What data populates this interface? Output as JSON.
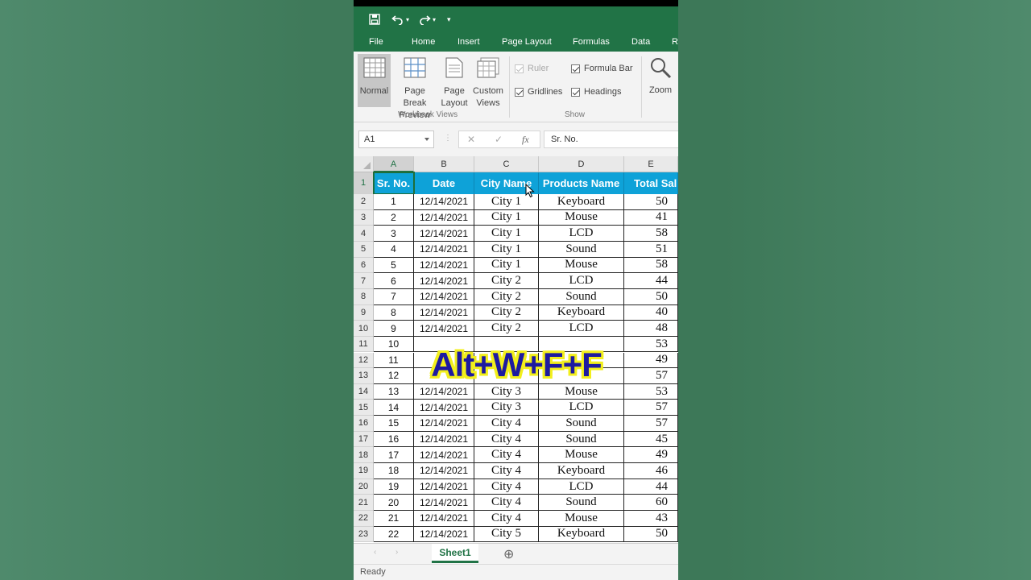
{
  "qat": {
    "save_icon": "save-icon",
    "undo_icon": "undo-icon",
    "redo_icon": "redo-icon",
    "customize_glyph": "▾"
  },
  "ribbon_tabs": [
    "File",
    "Home",
    "Insert",
    "Page Layout",
    "Formulas",
    "Data",
    "R"
  ],
  "ribbon": {
    "views": [
      {
        "line1": "Normal",
        "line2": "",
        "icon": "normal-view-icon"
      },
      {
        "line1": "Page Break",
        "line2": "Preview",
        "icon": "page-break-icon"
      },
      {
        "line1": "Page",
        "line2": "Layout",
        "icon": "page-layout-icon"
      },
      {
        "line1": "Custom",
        "line2": "Views",
        "icon": "custom-views-icon"
      }
    ],
    "views_group": "Workbook Views",
    "show": {
      "ruler": "Ruler",
      "formula_bar": "Formula Bar",
      "gridlines": "Gridlines",
      "headings": "Headings"
    },
    "show_group": "Show",
    "zoom": "Zoom"
  },
  "formula_bar": {
    "name_box": "A1",
    "cancel": "✕",
    "enter": "✓",
    "fx": "fx",
    "content": "Sr. No."
  },
  "columns": [
    "A",
    "B",
    "C",
    "D",
    "E"
  ],
  "table": {
    "headers": [
      "Sr. No.",
      "Date",
      "City Name",
      "Products Name",
      "Total Sal"
    ],
    "rows": [
      [
        "1",
        "12/14/2021",
        "City 1",
        "Keyboard",
        "50"
      ],
      [
        "2",
        "12/14/2021",
        "City 1",
        "Mouse",
        "41"
      ],
      [
        "3",
        "12/14/2021",
        "City 1",
        "LCD",
        "58"
      ],
      [
        "4",
        "12/14/2021",
        "City 1",
        "Sound",
        "51"
      ],
      [
        "5",
        "12/14/2021",
        "City 1",
        "Mouse",
        "58"
      ],
      [
        "6",
        "12/14/2021",
        "City 2",
        "LCD",
        "44"
      ],
      [
        "7",
        "12/14/2021",
        "City 2",
        "Sound",
        "50"
      ],
      [
        "8",
        "12/14/2021",
        "City 2",
        "Keyboard",
        "40"
      ],
      [
        "9",
        "12/14/2021",
        "City 2",
        "LCD",
        "48"
      ],
      [
        "10",
        "",
        "",
        "",
        "53"
      ],
      [
        "11",
        "",
        "",
        "",
        "49"
      ],
      [
        "12",
        "",
        "",
        "",
        "57"
      ],
      [
        "13",
        "12/14/2021",
        "City 3",
        "Mouse",
        "53"
      ],
      [
        "14",
        "12/14/2021",
        "City 3",
        "LCD",
        "57"
      ],
      [
        "15",
        "12/14/2021",
        "City 4",
        "Sound",
        "57"
      ],
      [
        "16",
        "12/14/2021",
        "City 4",
        "Sound",
        "45"
      ],
      [
        "17",
        "12/14/2021",
        "City 4",
        "Mouse",
        "49"
      ],
      [
        "18",
        "12/14/2021",
        "City 4",
        "Keyboard",
        "46"
      ],
      [
        "19",
        "12/14/2021",
        "City 4",
        "LCD",
        "44"
      ],
      [
        "20",
        "12/14/2021",
        "City 4",
        "Sound",
        "60"
      ],
      [
        "21",
        "12/14/2021",
        "City 4",
        "Mouse",
        "43"
      ],
      [
        "22",
        "12/14/2021",
        "City 5",
        "Keyboard",
        "50"
      ]
    ]
  },
  "sheet_tabs": {
    "active": "Sheet1",
    "add_icon": "⊕"
  },
  "status": "Ready",
  "overlay_text": "Alt+W+F+F",
  "colors": {
    "excel_green": "#217346",
    "header_blue": "#0ea2d8",
    "overlay_yellow": "#f2ef1c",
    "overlay_blue": "#1d1aa0"
  }
}
